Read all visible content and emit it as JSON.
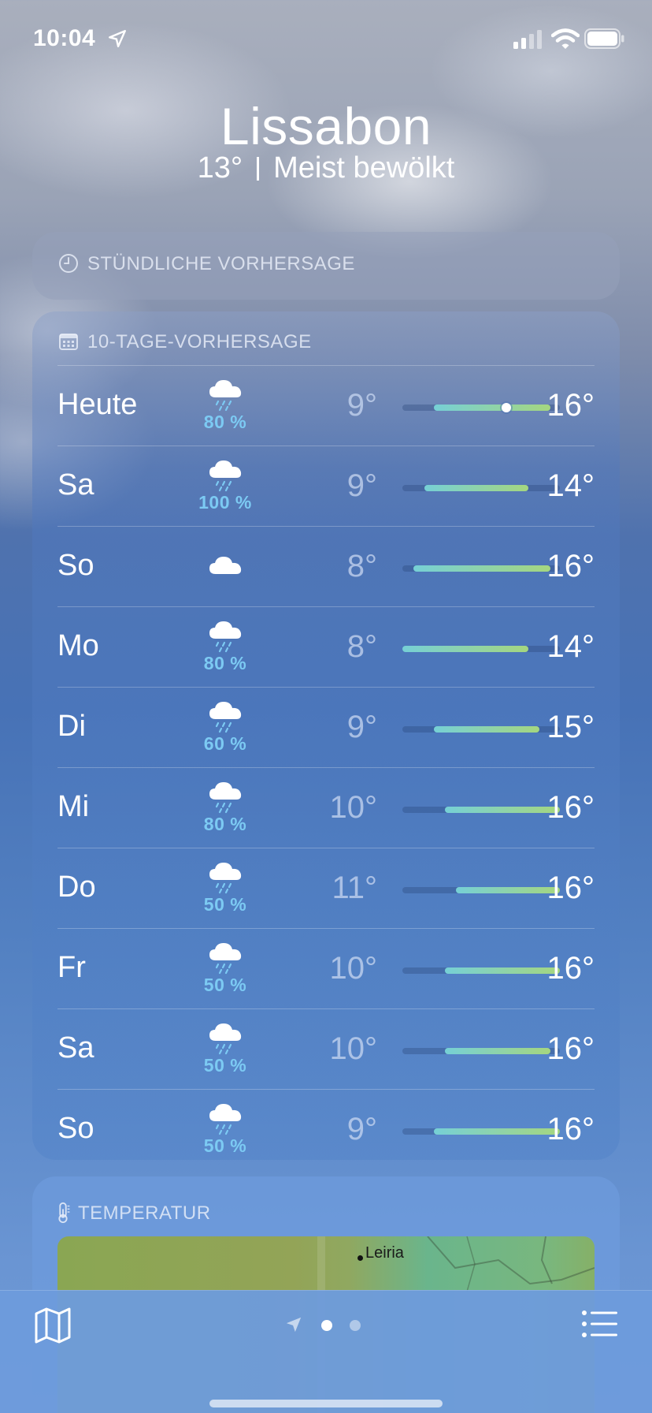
{
  "status_bar": {
    "time": "10:04",
    "icons": [
      "location-arrow-icon",
      "cellular-signal-icon",
      "wifi-icon",
      "battery-icon"
    ]
  },
  "header": {
    "city": "Lissabon",
    "temperature": "13°",
    "condition": "Meist bewölkt"
  },
  "hourly": {
    "title": "STÜNDLICHE VORHERSAGE",
    "icon": "clock-icon"
  },
  "daily": {
    "title": "10-TAGE-VORHERSAGE",
    "icon": "calendar-icon",
    "days": [
      {
        "day": "Heute",
        "icon": "cloud-rain-icon",
        "precip": "80 %",
        "low": "9°",
        "high": "16°",
        "range_start": 0.2,
        "range_end": 0.94,
        "current": 0.66
      },
      {
        "day": "Sa",
        "icon": "cloud-rain-icon",
        "precip": "100 %",
        "low": "9°",
        "high": "14°",
        "range_start": 0.14,
        "range_end": 0.8
      },
      {
        "day": "So",
        "icon": "cloud-icon",
        "precip": "",
        "low": "8°",
        "high": "16°",
        "range_start": 0.07,
        "range_end": 0.94
      },
      {
        "day": "Mo",
        "icon": "cloud-rain-icon",
        "precip": "80 %",
        "low": "8°",
        "high": "14°",
        "range_start": 0.0,
        "range_end": 0.8
      },
      {
        "day": "Di",
        "icon": "cloud-rain-icon",
        "precip": "60 %",
        "low": "9°",
        "high": "15°",
        "range_start": 0.2,
        "range_end": 0.87
      },
      {
        "day": "Mi",
        "icon": "cloud-rain-icon",
        "precip": "80 %",
        "low": "10°",
        "high": "16°",
        "range_start": 0.27,
        "range_end": 1.0
      },
      {
        "day": "Do",
        "icon": "cloud-rain-icon",
        "precip": "50 %",
        "low": "11°",
        "high": "16°",
        "range_start": 0.34,
        "range_end": 1.0
      },
      {
        "day": "Fr",
        "icon": "cloud-rain-icon",
        "precip": "50 %",
        "low": "10°",
        "high": "16°",
        "range_start": 0.27,
        "range_end": 1.0
      },
      {
        "day": "Sa",
        "icon": "cloud-rain-icon",
        "precip": "50 %",
        "low": "10°",
        "high": "16°",
        "range_start": 0.27,
        "range_end": 0.94
      },
      {
        "day": "So",
        "icon": "cloud-rain-icon",
        "precip": "50 %",
        "low": "9°",
        "high": "16°",
        "range_start": 0.2,
        "range_end": 1.0
      }
    ]
  },
  "temperature_card": {
    "title": "TEMPERATUR",
    "icon": "thermometer-icon",
    "map_place": "Leiria"
  },
  "bottom_bar": {
    "left_icon": "map-icon",
    "right_icon": "list-icon",
    "pages": 2,
    "active_page": 1
  },
  "colors": {
    "precip_text": "#7ccaf3",
    "bar_start": "#76d0d6",
    "bar_end": "#a5d67f"
  }
}
